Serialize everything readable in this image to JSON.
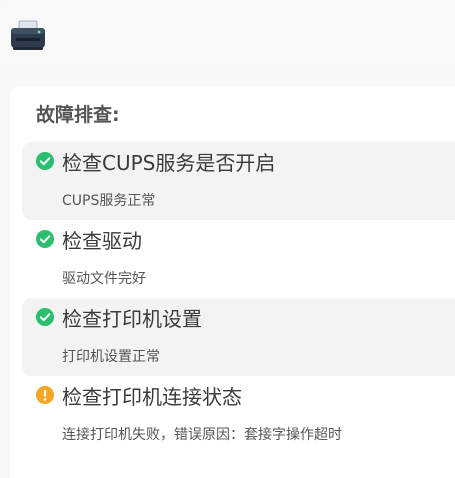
{
  "app": {
    "icon": "printer-icon"
  },
  "troubleshoot": {
    "title": "故障排查:",
    "items": [
      {
        "title": "检查CUPS服务是否开启",
        "description": "CUPS服务正常",
        "status": "success",
        "icon": "check-circle-icon"
      },
      {
        "title": "检查驱动",
        "description": "驱动文件完好",
        "status": "success",
        "icon": "check-circle-icon"
      },
      {
        "title": "检查打印机设置",
        "description": "打印机设置正常",
        "status": "success",
        "icon": "check-circle-icon"
      },
      {
        "title": "检查打印机连接状态",
        "description": "连接打印机失败，错误原因：套接字操作超时",
        "status": "warning",
        "icon": "warning-circle-icon"
      }
    ]
  },
  "colors": {
    "success": "#2dbd6e",
    "warning": "#f5a623",
    "row_shade": "#f3f3f3"
  }
}
